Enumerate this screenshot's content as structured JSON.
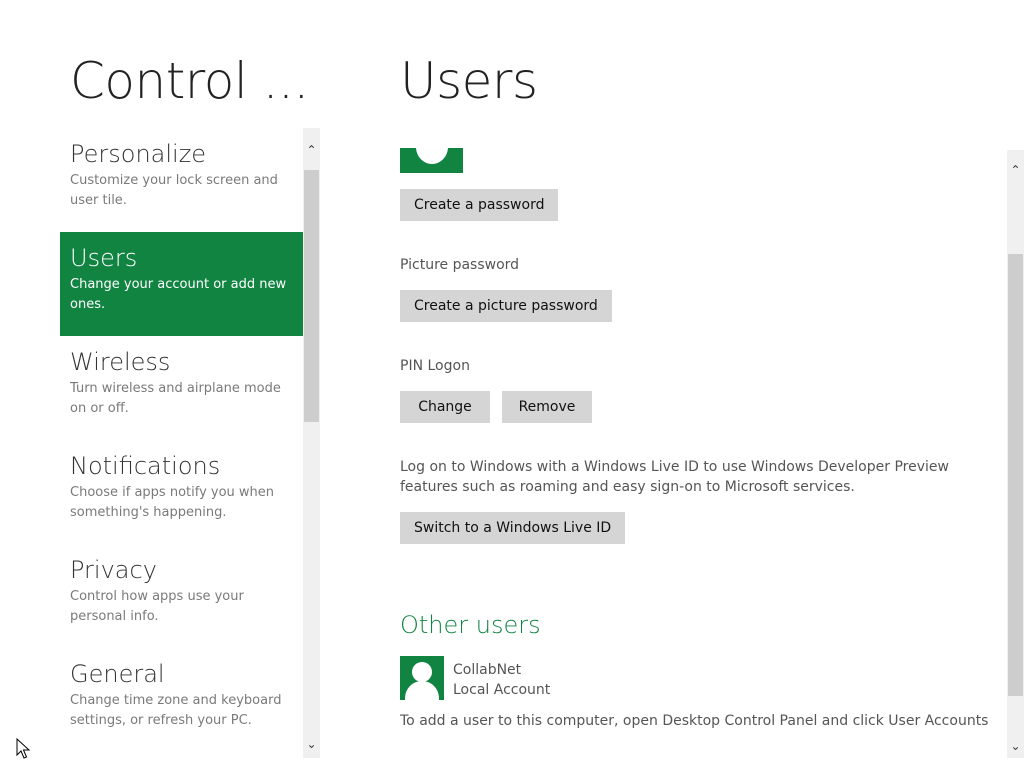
{
  "app": {
    "title": "Control ..."
  },
  "nav": {
    "items": [
      {
        "title": "Personalize",
        "desc": "Customize your lock screen and user tile."
      },
      {
        "title": "Users",
        "desc": "Change your account or add new ones."
      },
      {
        "title": "Wireless",
        "desc": "Turn wireless and airplane mode on or off."
      },
      {
        "title": "Notifications",
        "desc": "Choose if apps notify you when something's happening."
      },
      {
        "title": "Privacy",
        "desc": "Control how apps use your personal info."
      },
      {
        "title": "General",
        "desc": "Change time zone and keyboard settings, or refresh your PC."
      }
    ],
    "selected_index": 1
  },
  "page": {
    "title": "Users"
  },
  "account": {
    "create_password_label": "Create a password",
    "picture_password_label": "Picture password",
    "create_picture_password_label": "Create a picture password",
    "pin_logon_label": "PIN Logon",
    "change_label": "Change",
    "remove_label": "Remove",
    "live_id_text": "Log on to Windows with a Windows Live ID to use Windows Developer Preview features such as roaming and easy sign-on to Microsoft services.",
    "switch_live_id_label": "Switch to a Windows Live ID"
  },
  "other_users": {
    "header": "Other users",
    "users": [
      {
        "name": "CollabNet",
        "type": "Local Account"
      }
    ],
    "add_user_text": "To add a user to this computer, open Desktop Control Panel and click User Accounts"
  },
  "icons": {
    "scroll_up": "chevron-up-icon",
    "scroll_down": "chevron-down-icon",
    "avatar": "user-avatar-icon",
    "cursor": "mouse-pointer-icon"
  },
  "colors": {
    "accent": "#118442",
    "button_bg": "#d5d5d5",
    "scrollbar_track": "#f0f0f0",
    "scrollbar_thumb": "#cdcdcd"
  }
}
